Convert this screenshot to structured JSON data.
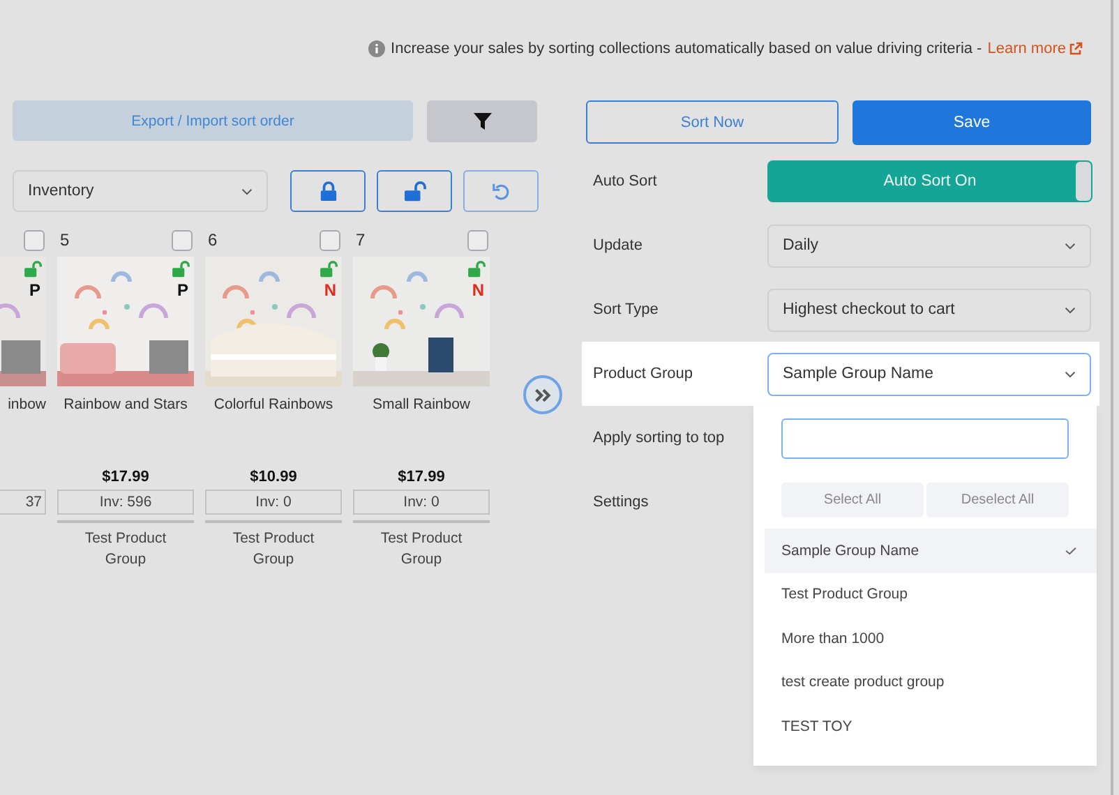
{
  "info": {
    "text": "Increase your sales by sorting collections automatically based on value driving criteria -",
    "link": "Learn more"
  },
  "toolbar": {
    "export_button": "Export / Import sort order",
    "sort_select": "Inventory"
  },
  "actions": {
    "sort_now": "Sort Now",
    "save": "Save"
  },
  "products": [
    {
      "checked": false,
      "badge": "P",
      "color": "#111111",
      "locked": false,
      "title": "inbow",
      "inventory": "37"
    },
    {
      "number": "5",
      "checked": false,
      "badge": "P",
      "color": "#111111",
      "locked": false,
      "title": "Rainbow and Stars",
      "price": "$17.99",
      "inventory": "Inv: 596",
      "group": "Test Product Group"
    },
    {
      "number": "6",
      "checked": false,
      "badge": "N",
      "color": "#e02b1d",
      "locked": false,
      "title": "Colorful Rainbows",
      "price": "$10.99",
      "inventory": "Inv: 0",
      "group": "Test Product Group"
    },
    {
      "number": "7",
      "checked": false,
      "badge": "N",
      "color": "#e02b1d",
      "locked": false,
      "title": "Small Rainbow",
      "price": "$17.99",
      "inventory": "Inv: 0",
      "group": "Test Product Group"
    }
  ],
  "settings": [
    {
      "label": "Auto Sort",
      "kind": "toggle",
      "value": "Auto Sort On",
      "on": true,
      "highlighted": false
    },
    {
      "label": "Update",
      "kind": "select",
      "value": "Daily",
      "highlighted": false
    },
    {
      "label": "Sort Type",
      "kind": "select",
      "value": "Highest checkout to cart",
      "highlighted": false
    },
    {
      "label": "Product Group",
      "kind": "select",
      "value": "Sample Group Name",
      "highlighted": true,
      "expanded": true
    },
    {
      "label": "Apply sorting to top",
      "kind": "none",
      "highlighted": false
    },
    {
      "label": "Settings",
      "kind": "none",
      "highlighted": false
    }
  ],
  "dropdown": {
    "select_all": "Select All",
    "deselect_all": "Deselect All",
    "options": [
      {
        "label": "Sample Group Name",
        "selected": true
      },
      {
        "label": "Test Product Group",
        "selected": false
      },
      {
        "label": "More than 1000",
        "selected": false
      },
      {
        "label": "test create product group",
        "selected": false
      },
      {
        "label": "TEST TOY",
        "selected": false
      }
    ]
  }
}
